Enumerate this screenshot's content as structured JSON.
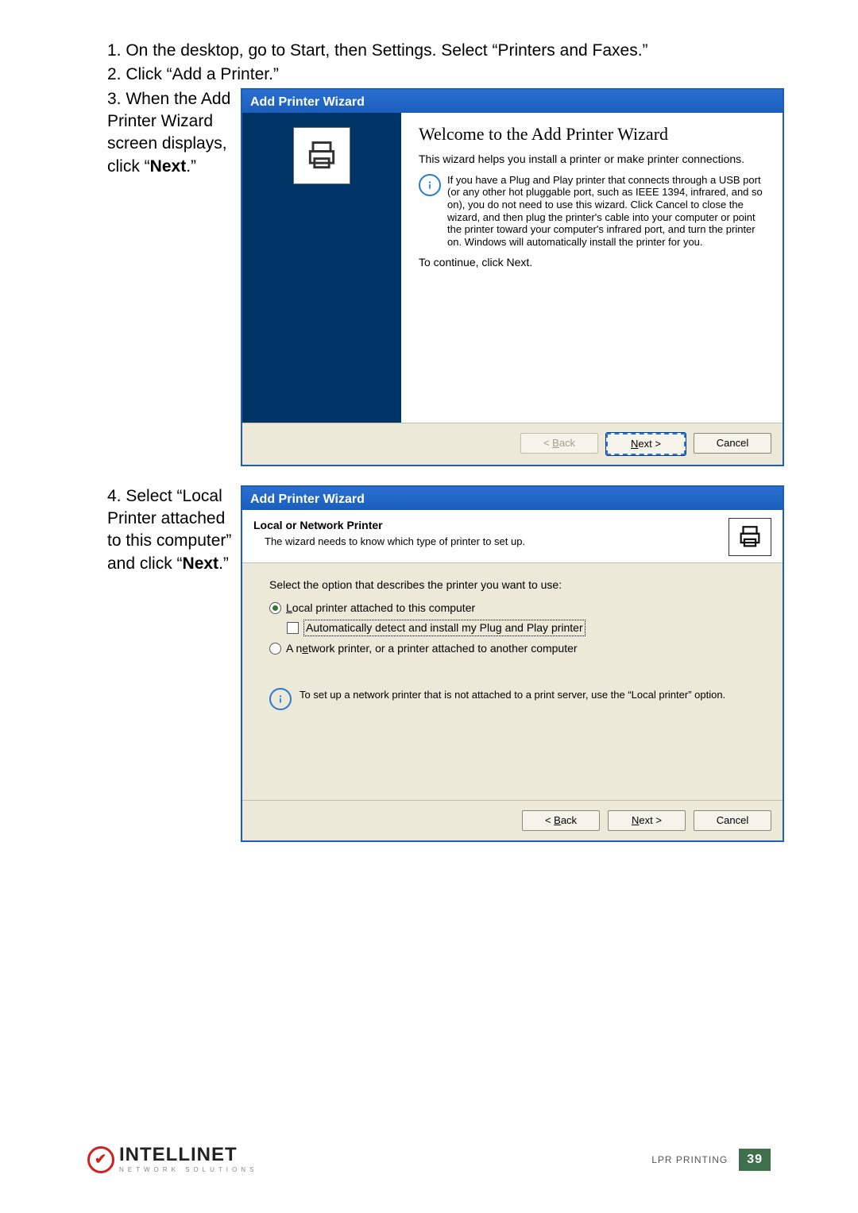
{
  "steps": {
    "s1": "1. On the desktop, go to Start, then Settings. Select “Printers and Faxes.”",
    "s2": "2. Click “Add a Printer.”",
    "s3_pre": "3. When the Add Printer Wizard screen displays, click “",
    "s3_next": "Next",
    "s3_post": ".”",
    "s4_pre": "4. Select “Local Printer attached to this computer” and click “",
    "s4_next": "Next",
    "s4_post": ".”"
  },
  "wizard1": {
    "title": "Add Printer Wizard",
    "heading": "Welcome to the Add Printer Wizard",
    "intro": "This wizard helps you install a printer or make printer connections.",
    "info": "If you have a Plug and Play printer that connects through a USB port (or any other hot pluggable port, such as IEEE 1394, infrared, and so on), you do not need to use this wizard. Click Cancel to close the wizard, and then plug the printer's cable into your computer or point the printer toward your computer's infrared port, and turn the printer on. Windows will automatically install the printer for you.",
    "continue": "To continue, click Next.",
    "back": "< Back",
    "next": "Next >",
    "cancel": "Cancel"
  },
  "wizard2": {
    "title": "Add Printer Wizard",
    "header_title": "Local or Network Printer",
    "header_sub": "The wizard needs to know which type of printer to set up.",
    "prompt": "Select the option that describes the printer you want to use:",
    "opt_local": "Local printer attached to this computer",
    "chk_auto": "Automatically detect and install my Plug and Play printer",
    "opt_net": "A network printer, or a printer attached to another computer",
    "info": "To set up a network printer that is not attached to a print server, use the “Local printer” option.",
    "back": "< Back",
    "next": "Next >",
    "cancel": "Cancel"
  },
  "footer": {
    "brand": "INTELLINET",
    "brand_sub": "NETWORK SOLUTIONS",
    "section": "LPR PRINTING",
    "page": "39"
  }
}
